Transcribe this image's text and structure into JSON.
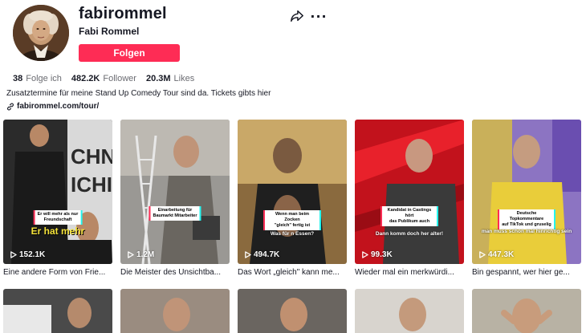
{
  "profile": {
    "username": "fabirommel",
    "nickname": "Fabi Rommel",
    "follow_label": "Folgen",
    "bio": "Zusatztermine für meine Stand Up Comedy Tour sind da. Tickets gibts hier",
    "link": "fabirommel.com/tour/",
    "more_label": "···"
  },
  "stats": [
    {
      "value": "38",
      "label": "Folge ich"
    },
    {
      "value": "482.2K",
      "label": "Follower"
    },
    {
      "value": "20.3M",
      "label": "Likes"
    }
  ],
  "videos": [
    {
      "views": "152.1K",
      "title": "Eine andere Form von Frie...",
      "caption": "Er will mehr als nur\nFreundschaft",
      "subtitle": "Er hat mehr",
      "subtitle_style": "big"
    },
    {
      "views": "1.2M",
      "title": "Die Meister des Unsichtba...",
      "caption": "Einarbeitung für\nBaumarkt Mitarbeiter",
      "subtitle": ""
    },
    {
      "views": "494.7K",
      "title": "Das Wort „gleich\" kann me...",
      "caption": "Wenn man beim Zocken\n\"gleich\" fertig ist",
      "subtitle": "Was für n Essen?"
    },
    {
      "views": "99.3K",
      "title": "Wieder mal ein merkwürdi...",
      "caption": "Kandidat in Castings hört\ndas Publikum auch",
      "subtitle": "Dann komm doch her alter!"
    },
    {
      "views": "447.3K",
      "title": "Bin gespannt, wer hier ge...",
      "caption": "Deutsche Topkommentare\nauf TikTok und gruselig",
      "subtitle": "man muss schon mal hinrichtig sein"
    }
  ],
  "colors": {
    "accent": "#fe2c55",
    "cyan": "#25f4ee"
  }
}
